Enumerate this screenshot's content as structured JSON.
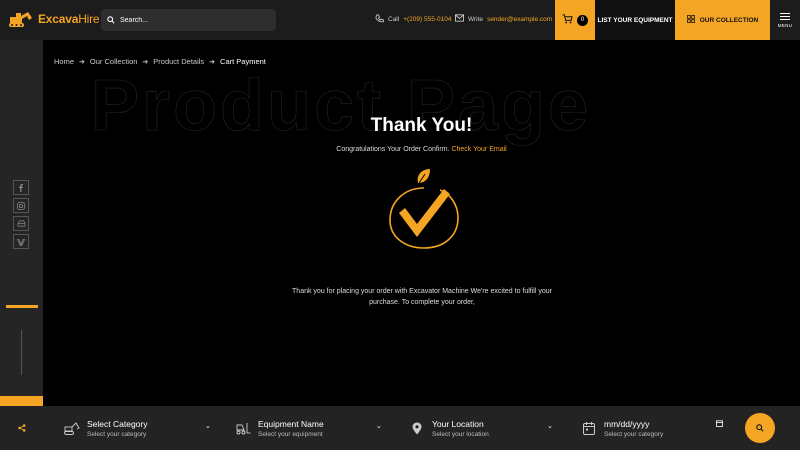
{
  "header": {
    "logo": {
      "brand": "Excava",
      "brand_suffix": "Hire"
    },
    "search": {
      "placeholder": "Search..."
    },
    "call": {
      "label": "Call",
      "value": "+(209) 555-0104"
    },
    "write": {
      "label": "Write",
      "value": "sender@example.com"
    },
    "cart": {
      "count": "0"
    },
    "list_equipment_label": "LIST YOUR EQUIPMENT",
    "our_collection_label": "OUR COLLECTION",
    "menu_label": "MENU"
  },
  "breadcrumb": {
    "items": [
      "Home",
      "Our Collection",
      "Product Details"
    ],
    "current": "Cart Payment"
  },
  "main": {
    "watermark": "Product Page",
    "title": "Thank You!",
    "subtitle": "Congratulations Your Order Confirm.",
    "subtitle_link": "Check Your Email",
    "message": "Thank you for placing your order with Excavator Machine We're excited to fulfill your purchase. To complete your order,"
  },
  "bottom_bar": {
    "category": {
      "label": "Select Category",
      "hint": "Select your category"
    },
    "equipment": {
      "label": "Equipment Name",
      "hint": "Select your equipment"
    },
    "location": {
      "label": "Your Location",
      "hint": "Select your location"
    },
    "date": {
      "placeholder": "mm/dd/yyyy",
      "hint": "Select your category"
    }
  },
  "colors": {
    "accent": "#f5a524",
    "background": "#000000",
    "panel": "#1c1c1c"
  },
  "icons": [
    "excavator-logo-icon",
    "search-icon",
    "phone-icon",
    "mail-icon",
    "cart-icon",
    "grid-icon",
    "menu-icon",
    "facebook-icon",
    "instagram-icon",
    "car-icon",
    "vimeo-icon",
    "plus-icon",
    "share-icon",
    "excavator-icon",
    "forklift-icon",
    "location-pin-icon",
    "calendar-icon",
    "chevron-down-icon",
    "check-leaf-icon"
  ]
}
